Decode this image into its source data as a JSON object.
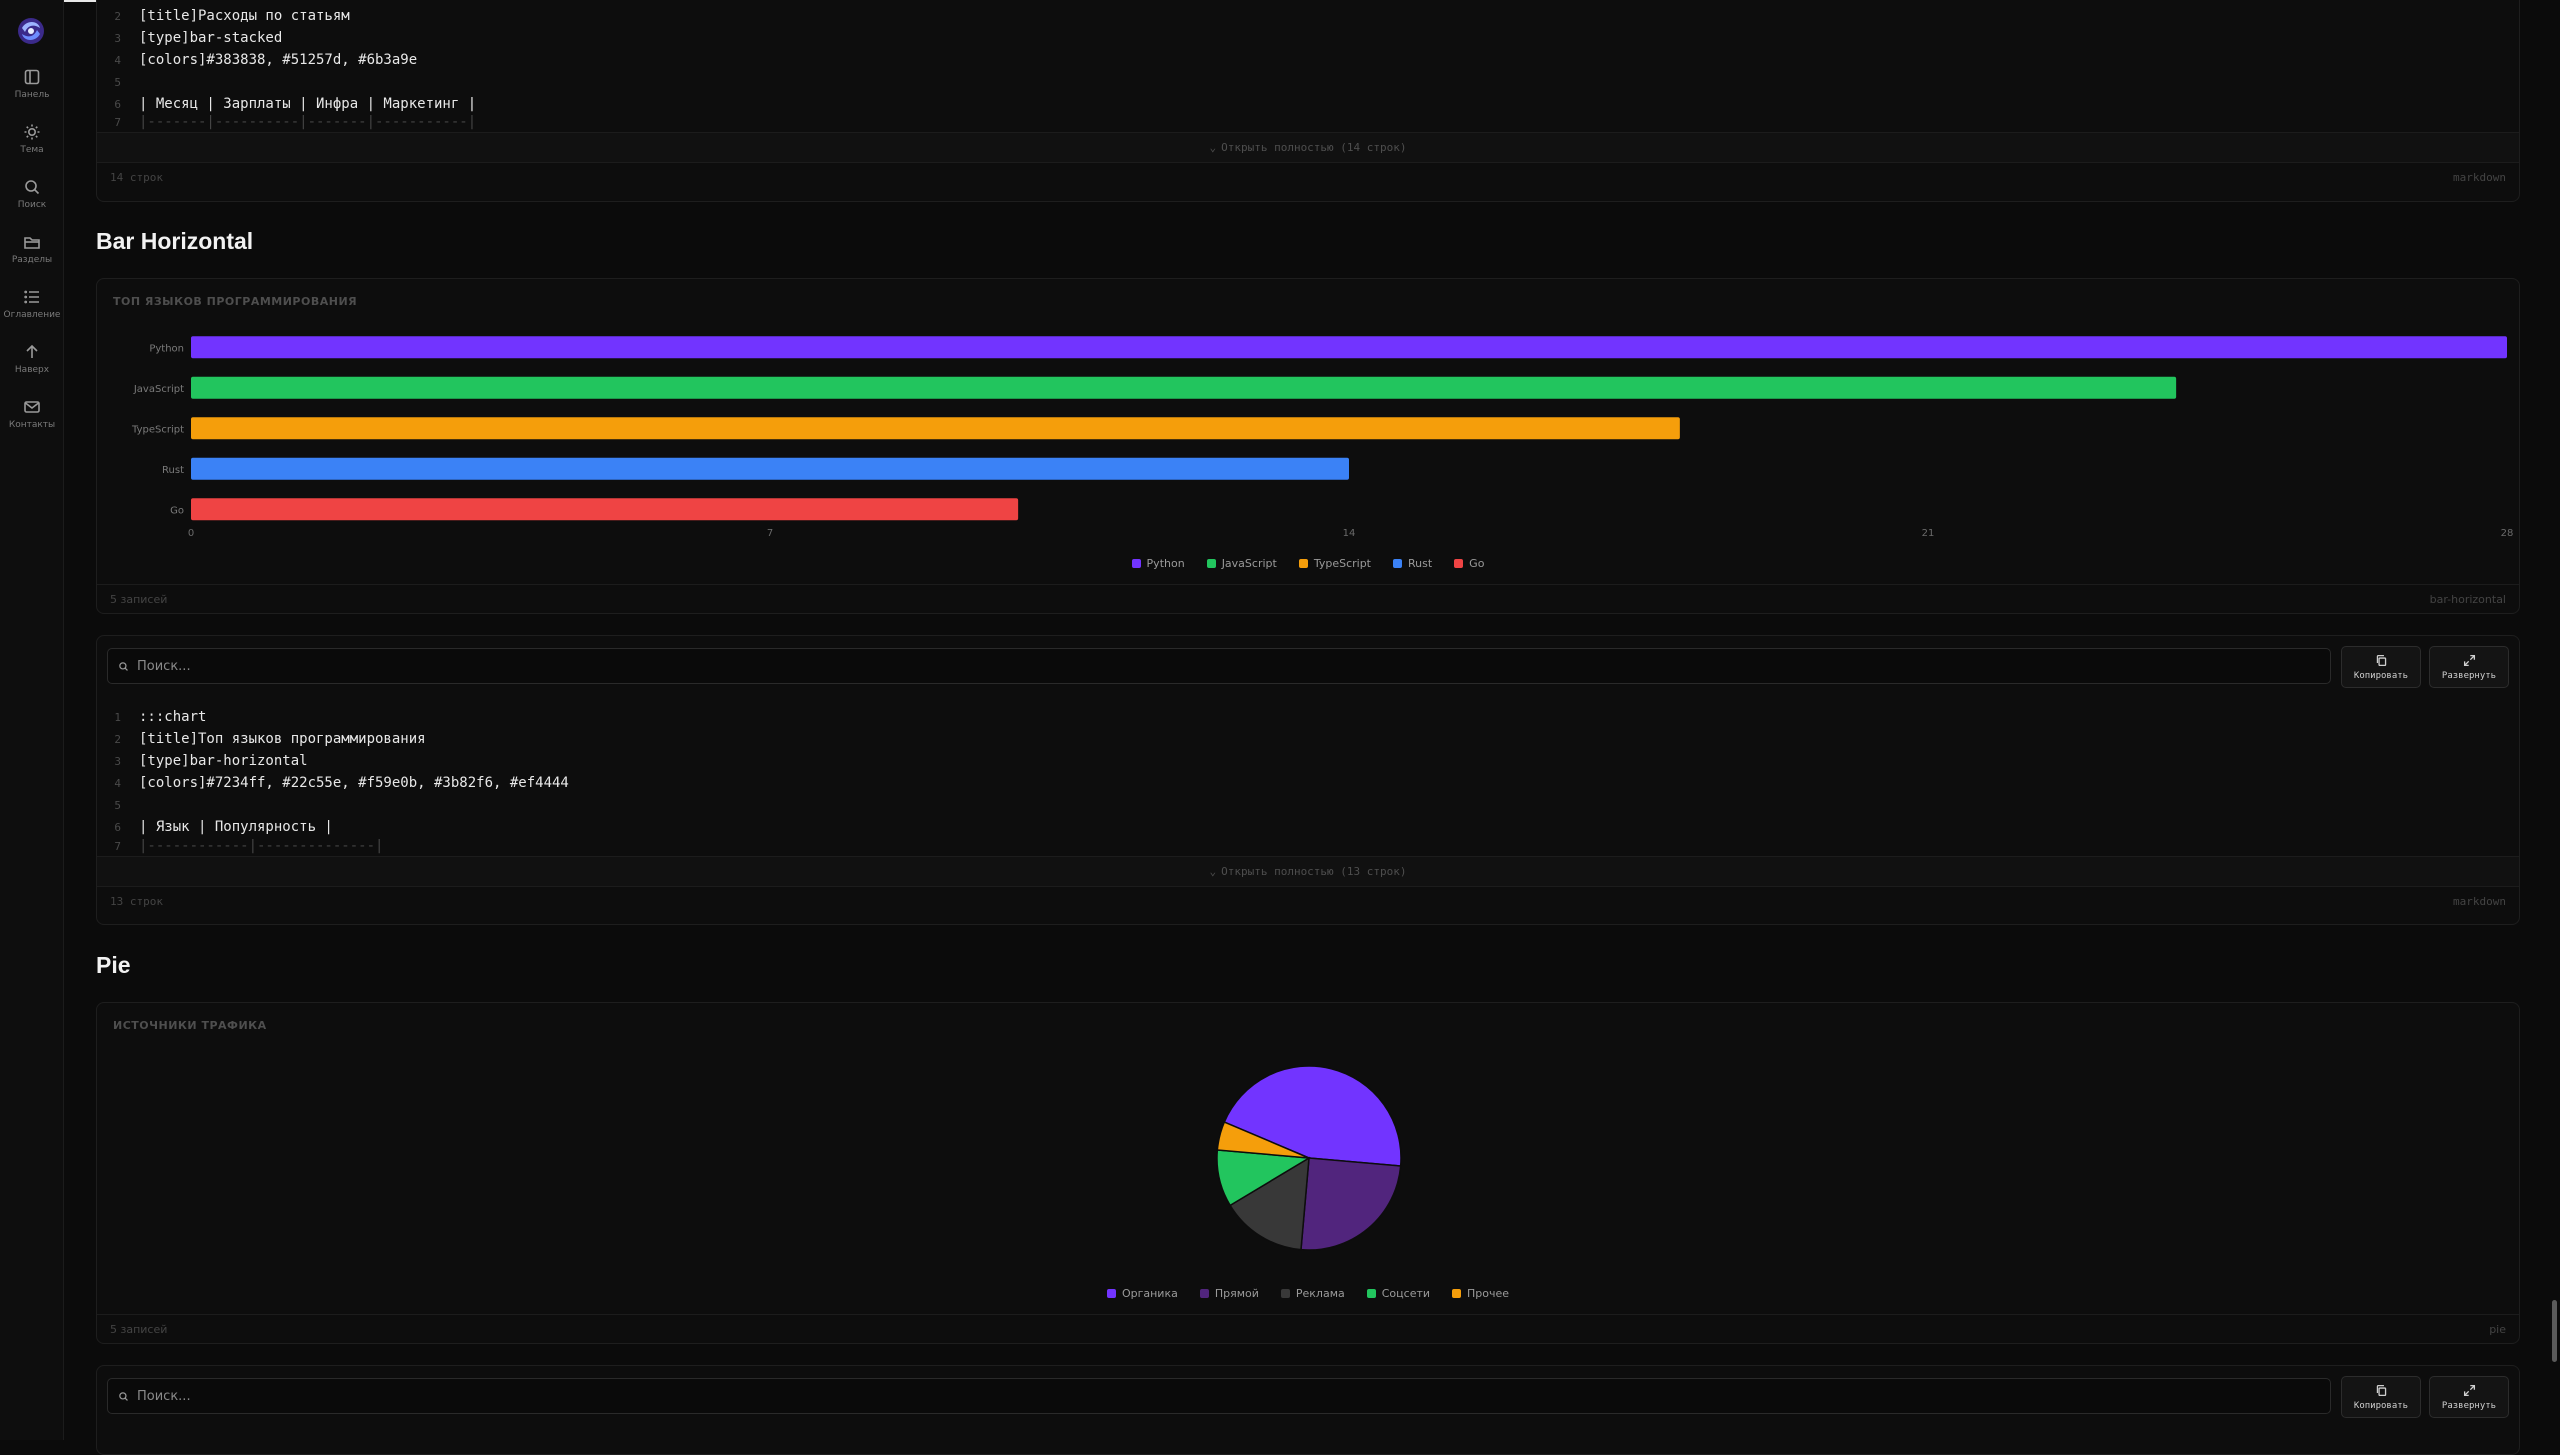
{
  "sidebar": {
    "items": [
      {
        "label": "Панель",
        "icon": "panel-icon"
      },
      {
        "label": "Тема",
        "icon": "sun-icon"
      },
      {
        "label": "Поиск",
        "icon": "search-icon"
      },
      {
        "label": "Разделы",
        "icon": "folder-icon"
      },
      {
        "label": "Оглавление",
        "icon": "list-icon"
      },
      {
        "label": "Наверх",
        "icon": "arrow-up-icon"
      },
      {
        "label": "Контакты",
        "icon": "mail-icon"
      }
    ]
  },
  "block1": {
    "lines": [
      {
        "n": "2",
        "text": "[title]Расходы по статьям"
      },
      {
        "n": "3",
        "text": "[type]bar-stacked"
      },
      {
        "n": "4",
        "text": "[colors]#383838, #51257d, #6b3a9e"
      },
      {
        "n": "5",
        "text": ""
      },
      {
        "n": "6",
        "text": "| Месяц | Зарплаты | Инфра | Маркетинг |"
      },
      {
        "n": "7",
        "text": "|-------|----------|-------|-----------|"
      }
    ],
    "expand_label": "Открыть полностью (14 строк)",
    "footer_left": "14 строк",
    "footer_right": "markdown"
  },
  "section_bar": {
    "heading": "Bar Horizontal"
  },
  "bar_card": {
    "footer_left": "5 записей",
    "footer_right": "bar-horizontal"
  },
  "block2": {
    "search_placeholder": "Поиск...",
    "copy_label": "Копировать",
    "expand_btn_label": "Развернуть",
    "lines": [
      {
        "n": "1",
        "text": ":::chart"
      },
      {
        "n": "2",
        "text": "[title]Топ языков программирования"
      },
      {
        "n": "3",
        "text": "[type]bar-horizontal"
      },
      {
        "n": "4",
        "text": "[colors]#7234ff, #22c55e, #f59e0b, #3b82f6, #ef4444"
      },
      {
        "n": "5",
        "text": ""
      },
      {
        "n": "6",
        "text": "| Язык       | Популярность |"
      },
      {
        "n": "7",
        "text": "|------------|--------------|"
      }
    ],
    "expand_label": "Открыть полностью (13 строк)",
    "footer_left": "13 строк",
    "footer_right": "markdown"
  },
  "section_pie": {
    "heading": "Pie"
  },
  "pie_card": {
    "footer_left": "5 записей",
    "footer_right": "pie"
  },
  "block3": {
    "search_placeholder": "Поиск...",
    "copy_label": "Копировать",
    "expand_btn_label": "Развернуть"
  },
  "chart_data": [
    {
      "type": "bar",
      "orientation": "horizontal",
      "title": "ТОП ЯЗЫКОВ ПРОГРАММИРОВАНИЯ",
      "categories": [
        "Python",
        "JavaScript",
        "TypeScript",
        "Rust",
        "Go"
      ],
      "values": [
        28,
        24,
        18,
        14,
        10
      ],
      "colors": [
        "#7234ff",
        "#22c55e",
        "#f59e0b",
        "#3b82f6",
        "#ef4444"
      ],
      "xlim": [
        0,
        28
      ],
      "xticks": [
        "0",
        "7",
        "14",
        "21",
        "28"
      ],
      "legend": [
        "Python",
        "JavaScript",
        "TypeScript",
        "Rust",
        "Go"
      ],
      "legend_position": "bottom"
    },
    {
      "type": "pie",
      "title": "ИСТОЧНИКИ ТРАФИКА",
      "categories": [
        "Органика",
        "Прямой",
        "Реклама",
        "Соцсети",
        "Прочее"
      ],
      "values": [
        45,
        25,
        15,
        10,
        5
      ],
      "colors": [
        "#7234ff",
        "#51257d",
        "#383838",
        "#22c55e",
        "#f59e0b"
      ],
      "legend_position": "bottom"
    }
  ]
}
